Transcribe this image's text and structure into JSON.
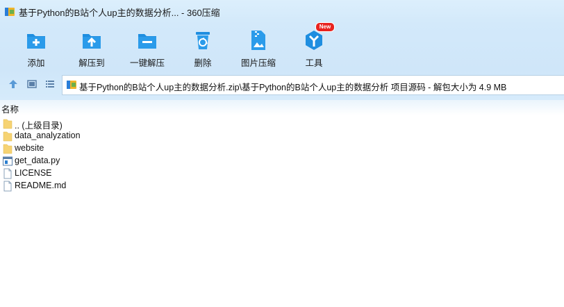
{
  "window": {
    "title": "基于Python的B站个人up主的数据分析... - 360压缩"
  },
  "toolbar": {
    "buttons": [
      {
        "label": "添加",
        "icon": "add-folder-icon"
      },
      {
        "label": "解压到",
        "icon": "extract-to-icon"
      },
      {
        "label": "一键解压",
        "icon": "one-click-extract-icon"
      },
      {
        "label": "删除",
        "icon": "recycle-bin-icon"
      },
      {
        "label": "图片压缩",
        "icon": "image-compress-icon"
      },
      {
        "label": "工具",
        "icon": "tools-icon"
      }
    ],
    "badge": "New"
  },
  "navigation": {
    "path": "基于Python的B站个人up主的数据分析.zip\\基于Python的B站个人up主的数据分析 项目源码 - 解包大小为 4.9 MB"
  },
  "file_list": {
    "column_name": "名称",
    "items": [
      {
        "name": ".. (上级目录)",
        "type": "parent"
      },
      {
        "name": "data_analyzation",
        "type": "folder"
      },
      {
        "name": "website",
        "type": "folder"
      },
      {
        "name": "get_data.py",
        "type": "python"
      },
      {
        "name": "LICENSE",
        "type": "file"
      },
      {
        "name": "README.md",
        "type": "file"
      }
    ]
  },
  "colors": {
    "toolbar_bg": "#d3e9fa",
    "icon_blue": "#1f8ee0",
    "badge_red": "#e8231f",
    "folder_yellow": "#f6d373"
  }
}
